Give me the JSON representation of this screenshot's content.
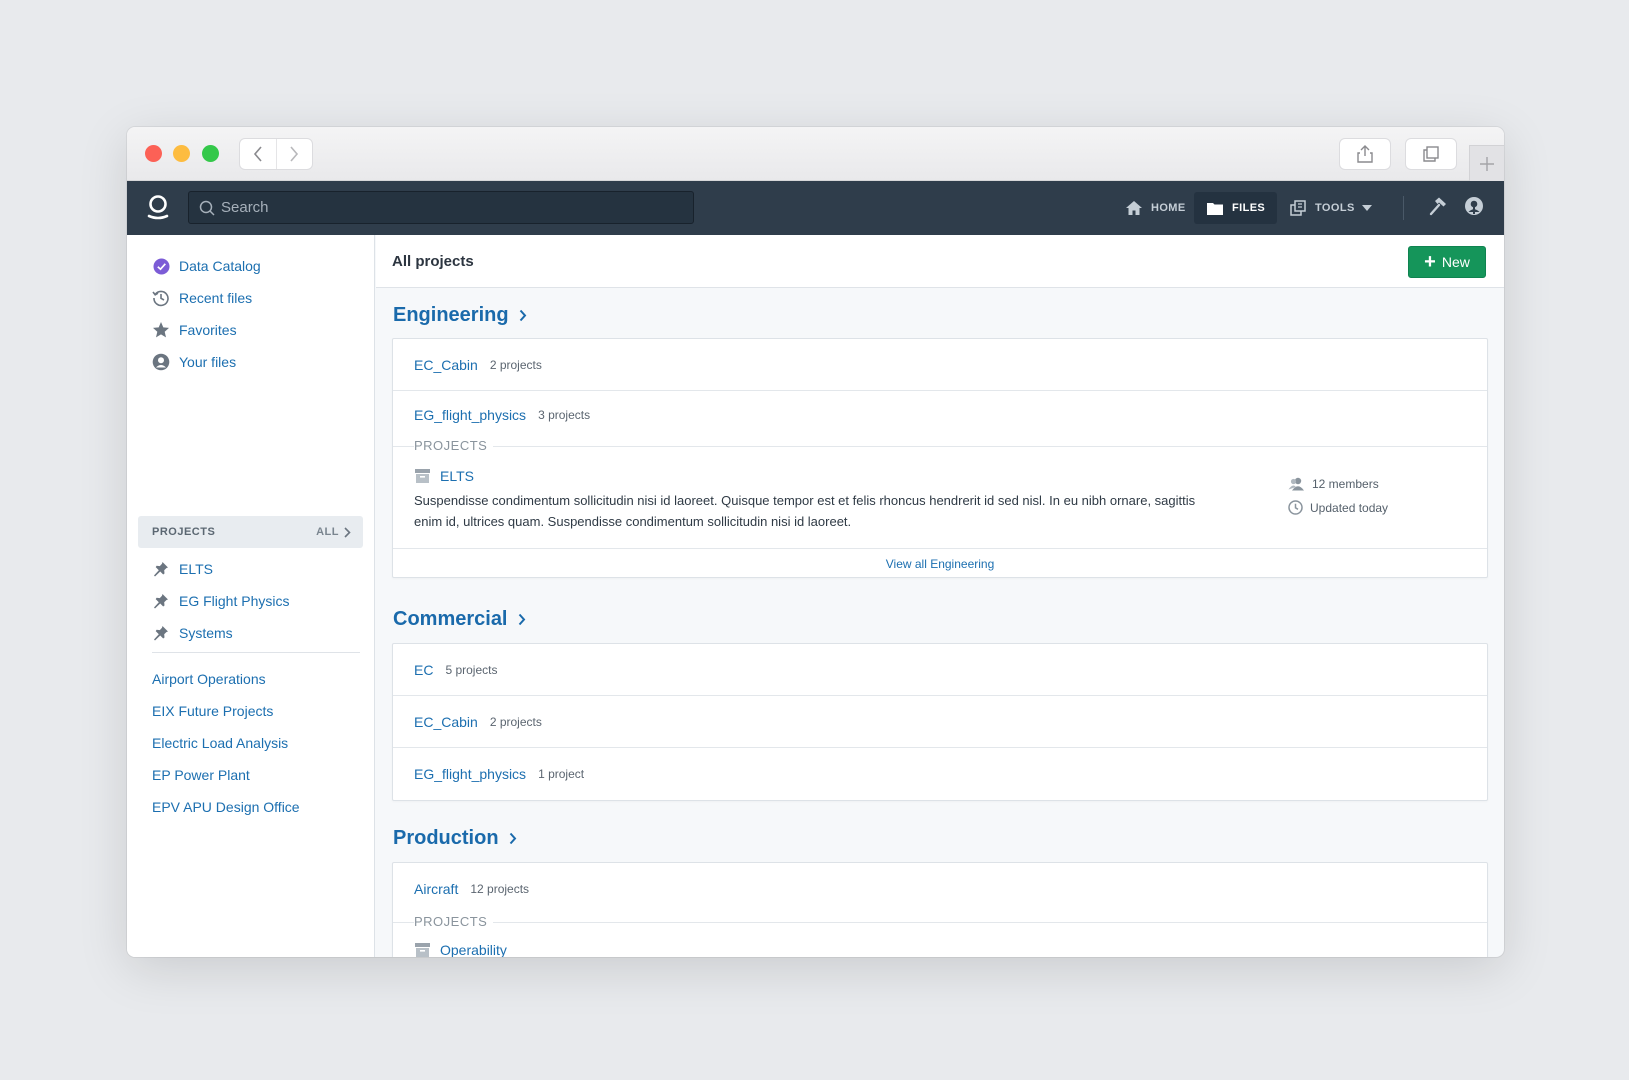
{
  "topbar": {
    "search_placeholder": "Search",
    "nav": {
      "home": "HOME",
      "files": "FILES",
      "tools": "TOOLS"
    }
  },
  "sidebar": {
    "items": [
      {
        "label": "Data Catalog",
        "icon": "check-circle-icon"
      },
      {
        "label": "Recent files",
        "icon": "history-icon"
      },
      {
        "label": "Favorites",
        "icon": "star-icon"
      },
      {
        "label": "Your files",
        "icon": "user-icon"
      }
    ],
    "projects_header": "PROJECTS",
    "projects_all": "ALL",
    "pinned": [
      {
        "label": "ELTS",
        "icon": "pin-icon"
      },
      {
        "label": "EG Flight Physics",
        "icon": "pin-icon"
      },
      {
        "label": "Systems",
        "icon": "pin-icon"
      }
    ],
    "links": [
      "Airport Operations",
      "EIX Future Projects",
      "Electric Load Analysis",
      "EP Power Plant",
      "EPV APU Design Office"
    ]
  },
  "main": {
    "title": "All projects",
    "new_button": "New",
    "sections": [
      {
        "title": "Engineering",
        "rows": [
          {
            "name": "EC_Cabin",
            "count": "2 projects"
          },
          {
            "name": "EG_flight_physics",
            "count": "3 projects"
          }
        ],
        "projects_label": "PROJECTS",
        "subproject": {
          "name": "ELTS",
          "description": "Suspendisse condimentum sollicitudin nisi id laoreet. Quisque tempor est et felis rhoncus hendrerit id sed nisl. In eu nibh ornare, sagittis enim id, ultrices quam. Suspendisse condimentum sollicitudin nisi id laoreet.",
          "members": "12 members",
          "updated": "Updated today"
        },
        "view_all": "View all Engineering"
      },
      {
        "title": "Commercial",
        "rows": [
          {
            "name": "EC",
            "count": "5 projects"
          },
          {
            "name": "EC_Cabin",
            "count": "2 projects"
          },
          {
            "name": "EG_flight_physics",
            "count": "1 project"
          }
        ]
      },
      {
        "title": "Production",
        "rows": [
          {
            "name": "Aircraft",
            "count": "12 projects"
          }
        ],
        "projects_label": "PROJECTS",
        "subproject": {
          "name": "Operability"
        }
      }
    ]
  },
  "colors": {
    "accent": "#1c6fb0",
    "topbar": "#2f3d4b",
    "new_button": "#15955a"
  }
}
